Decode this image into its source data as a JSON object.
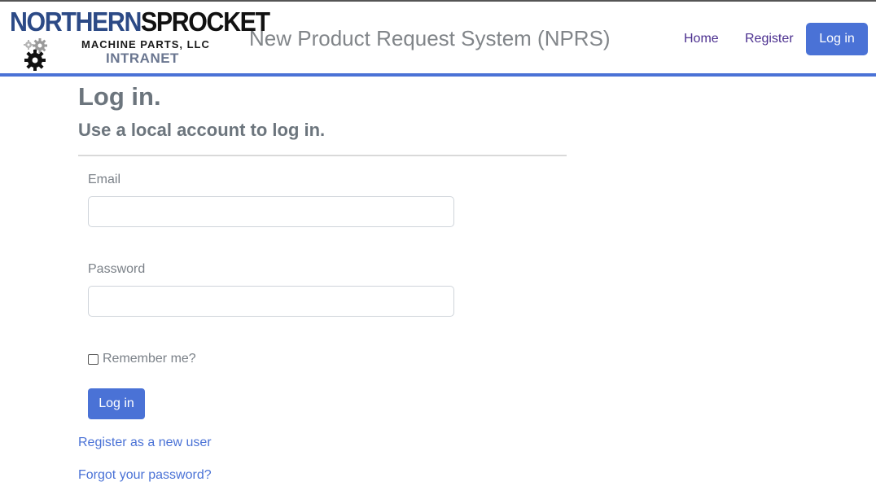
{
  "brand": {
    "logo_word_1": "NORTHERN",
    "logo_word_2": "SPROCKET",
    "logo_subtitle": "MACHINE PARTS, LLC",
    "logo_tagline": "INTRANET",
    "app_title": "New Product Request System (NPRS)",
    "accent_color": "#4a72d6"
  },
  "nav": {
    "home_label": "Home",
    "register_label": "Register",
    "login_label": "Log in"
  },
  "page": {
    "title": "Log in.",
    "subtitle": "Use a local account to log in."
  },
  "form": {
    "email_label": "Email",
    "email_value": "",
    "password_label": "Password",
    "password_value": "",
    "remember_label": "Remember me?",
    "remember_checked": false,
    "submit_label": "Log in"
  },
  "links": {
    "register_new_user": "Register as a new user",
    "forgot_password": "Forgot your password?"
  },
  "icons": {
    "logo_gears": "gears-icon",
    "checkbox": "checkbox-icon"
  }
}
